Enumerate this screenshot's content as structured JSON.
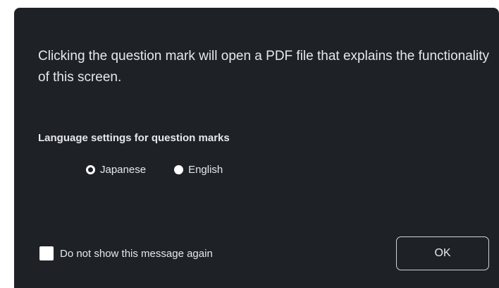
{
  "dialog": {
    "message": "Clicking the question mark will open a PDF file that explains the functionality of this screen.",
    "language_settings": {
      "title": "Language settings for question marks",
      "options": [
        {
          "label": "Japanese",
          "selected": true
        },
        {
          "label": "English",
          "selected": false
        }
      ]
    },
    "dont_show_again": {
      "label": "Do not show this message again",
      "checked": false
    },
    "ok_button": {
      "label": "OK"
    }
  },
  "colors": {
    "background": "#1e2227",
    "text": "#e6e8eb",
    "control": "#ffffff"
  }
}
